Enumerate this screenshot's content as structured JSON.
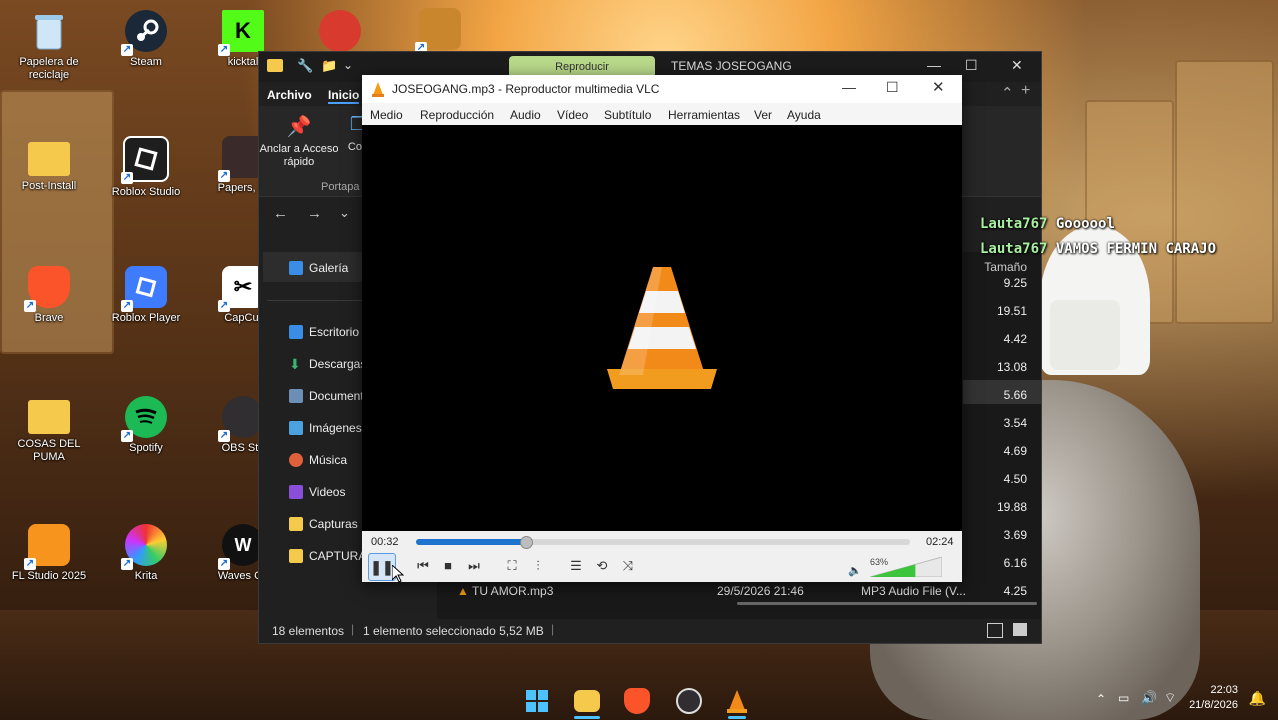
{
  "desktop": {
    "icons": [
      {
        "label": "Papelera de reciclaje",
        "icon": "recycle-bin-icon"
      },
      {
        "label": "Steam",
        "icon": "steam-icon"
      },
      {
        "label": "kicktal",
        "icon": "kick-icon"
      },
      {
        "label": "Post-Install",
        "icon": "folder-icon"
      },
      {
        "label": "Roblox Studio",
        "icon": "roblox-studio-icon"
      },
      {
        "label": "Papers, Pl",
        "icon": "papers-please-icon"
      },
      {
        "label": "Brave",
        "icon": "brave-icon"
      },
      {
        "label": "Roblox Player",
        "icon": "roblox-player-icon"
      },
      {
        "label": "CapCut",
        "icon": "capcut-icon"
      },
      {
        "label": "COSAS DEL PUMA",
        "icon": "folder-icon"
      },
      {
        "label": "Spotify",
        "icon": "spotify-icon"
      },
      {
        "label": "OBS Stu",
        "icon": "obs-icon"
      },
      {
        "label": "FL Studio 2025",
        "icon": "fl-studio-icon"
      },
      {
        "label": "Krita",
        "icon": "krita-icon"
      },
      {
        "label": "Waves Ce",
        "icon": "waves-icon"
      }
    ]
  },
  "explorer": {
    "play_tab": "Reproducir",
    "title": "TEMAS JOSEOGANG",
    "ribbon": {
      "archivo": "Archivo",
      "inicio": "Inicio"
    },
    "toolbar": {
      "pin_label": "Anclar a Acceso rápido",
      "copy_label": "Cop",
      "group_label": "Portapa"
    },
    "nav": [
      "Galería",
      "Escritorio",
      "Descargas",
      "Documentos",
      "Imágenes",
      "Música",
      "Videos",
      "Capturas",
      "CAPTURAS"
    ],
    "size_header": "Tamaño",
    "sizes": [
      "9.25",
      "19.51",
      "4.42",
      "13.08",
      "5.66",
      "3.54",
      "4.69",
      "4.50",
      "19.88",
      "3.69",
      "6.16",
      "4.25"
    ],
    "last_row": {
      "name": "TU AMOR.mp3",
      "date": "29/5/2026 21:46",
      "type": "MP3 Audio File (V..."
    },
    "status": {
      "count": "18 elementos",
      "selected": "1 elemento seleccionado 5,52 MB"
    }
  },
  "vlc": {
    "title": "JOSEOGANG.mp3 - Reproductor multimedia VLC",
    "menu": [
      "Medio",
      "Reproducción",
      "Audio",
      "Vídeo",
      "Subtítulo",
      "Herramientas",
      "Ver",
      "Ayuda"
    ],
    "time_elapsed": "00:32",
    "time_total": "02:24",
    "progress": 0.22,
    "volume": "63%",
    "volume_level": 0.63
  },
  "chat": [
    {
      "user": "Lauta767",
      "message": "Goooool"
    },
    {
      "user": "Lauta767",
      "message": "VAMOS FERMIN CARAJO"
    }
  ],
  "taskbar": {
    "time": "22:03",
    "date": "21/8/2026"
  }
}
